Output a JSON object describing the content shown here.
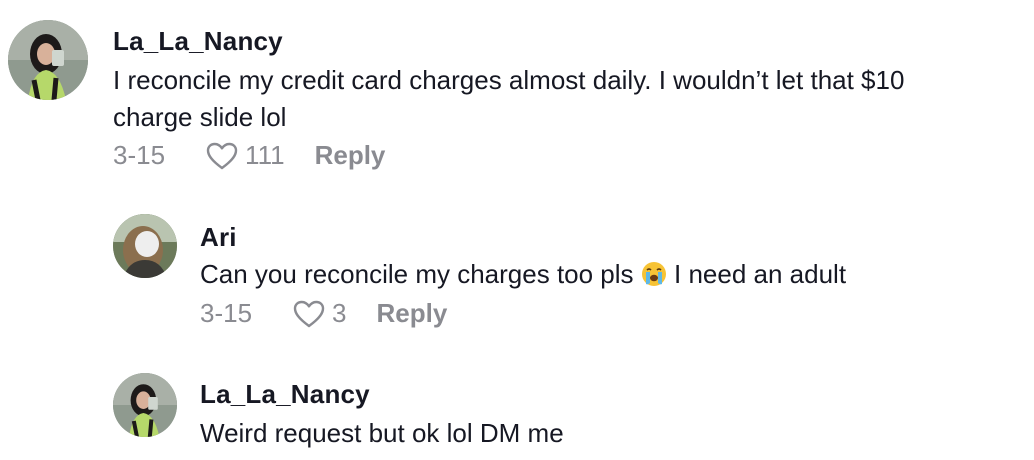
{
  "comments": [
    {
      "username": "La_La_Nancy",
      "text_line1": "I reconcile my credit card charges almost daily. I wouldn’t let that $10",
      "text_line2": "charge slide lol",
      "date": "3-15",
      "likes": "111",
      "reply_label": "Reply"
    },
    {
      "username": "Ari",
      "text_before_emoji": "Can you reconcile my charges too pls ",
      "emoji": "loudly-crying-face",
      "text_after_emoji": " I need an adult",
      "date": "3-15",
      "likes": "3",
      "reply_label": "Reply"
    },
    {
      "username": "La_La_Nancy",
      "text": "Weird request but ok lol DM me"
    }
  ],
  "icons": {
    "like": "heart-outline-icon"
  },
  "colors": {
    "text": "#161823",
    "meta": "#8a8b91"
  }
}
